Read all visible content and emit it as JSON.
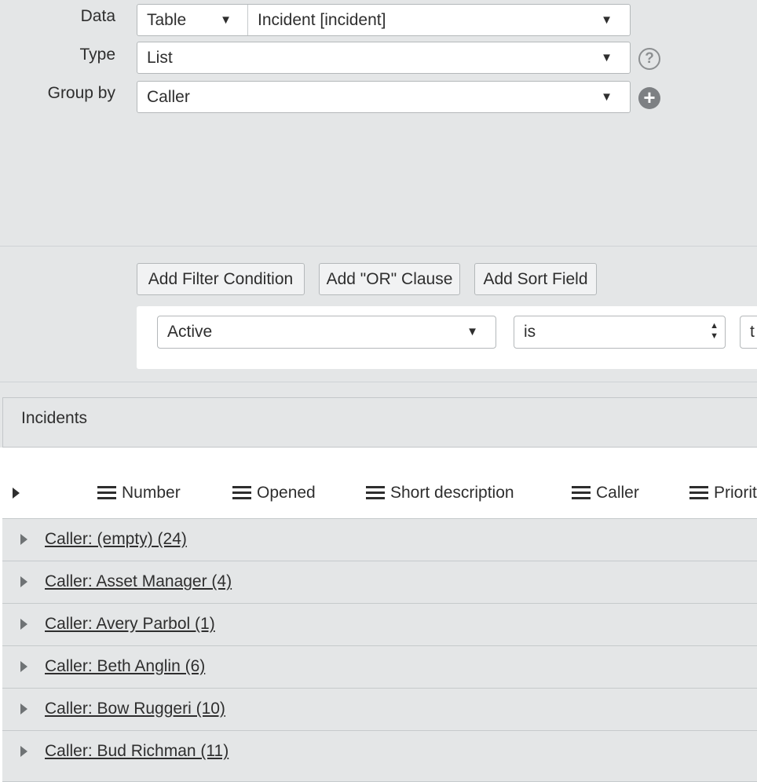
{
  "form": {
    "data_label": "Data",
    "data_source_type": "Table",
    "data_table": "Incident [incident]",
    "type_label": "Type",
    "type_value": "List",
    "group_by_label": "Group by",
    "group_by_value": "Caller"
  },
  "filter": {
    "add_condition_label": "Add Filter Condition",
    "add_or_label": "Add \"OR\" Clause",
    "add_sort_label": "Add Sort Field",
    "condition_field": "Active",
    "condition_operator": "is",
    "condition_value": "t"
  },
  "preview": {
    "title": "Incidents",
    "columns": [
      "Number",
      "Opened",
      "Short description",
      "Caller",
      "Priority"
    ],
    "groups": [
      "Caller: (empty) (24)",
      "Caller: Asset Manager (4)",
      "Caller: Avery Parbol (1)",
      "Caller: Beth Anglin (6)",
      "Caller: Bow Ruggeri (10)",
      "Caller: Bud Richman (11)"
    ]
  },
  "icons": {
    "help": "help-circle-icon",
    "add": "add-circle-icon",
    "caret": "caret-down-icon",
    "spinner": "spinner-updown-icon",
    "column_menu": "hamburger-icon",
    "expand": "triangle-right-icon"
  }
}
